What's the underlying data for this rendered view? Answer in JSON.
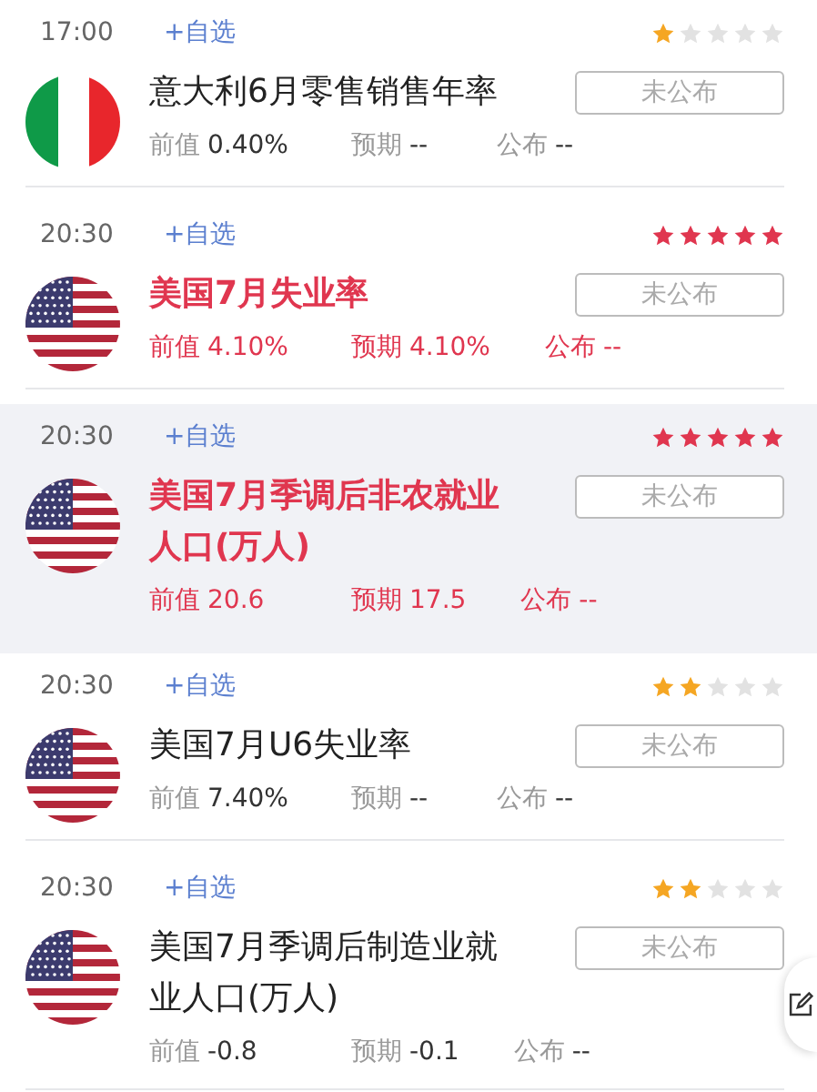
{
  "events": [
    {
      "time": "17:00",
      "watch": "+自选",
      "stars": 1,
      "kind": "italy",
      "title": "意大利6月零售销售年率",
      "important": false,
      "selected": false,
      "status": "未公布",
      "stats": [
        {
          "label": "前值",
          "value": "0.40%"
        },
        {
          "label": "预期",
          "value": "--"
        },
        {
          "label": "公布",
          "value": "--"
        }
      ]
    },
    {
      "time": "20:30",
      "watch": "+自选",
      "stars": 5,
      "kind": "usa",
      "title": "美国7月失业率",
      "important": true,
      "selected": false,
      "status": "未公布",
      "stats": [
        {
          "label": "前值",
          "value": "4.10%"
        },
        {
          "label": "预期",
          "value": "4.10%"
        },
        {
          "label": "公布",
          "value": "--"
        }
      ]
    },
    {
      "time": "20:30",
      "watch": "+自选",
      "stars": 5,
      "kind": "usa",
      "title": "美国7月季调后非农就业人口(万人)",
      "important": true,
      "selected": true,
      "status": "未公布",
      "stats": [
        {
          "label": "前值",
          "value": "20.6"
        },
        {
          "label": "预期",
          "value": "17.5"
        },
        {
          "label": "公布",
          "value": "--"
        }
      ]
    },
    {
      "time": "20:30",
      "watch": "+自选",
      "stars": 2,
      "kind": "usa",
      "title": "美国7月U6失业率",
      "important": false,
      "selected": false,
      "status": "未公布",
      "stats": [
        {
          "label": "前值",
          "value": "7.40%"
        },
        {
          "label": "预期",
          "value": "--"
        },
        {
          "label": "公布",
          "value": "--"
        }
      ]
    },
    {
      "time": "20:30",
      "watch": "+自选",
      "stars": 2,
      "kind": "usa",
      "title": "美国7月季调后制造业就业人口(万人)",
      "important": false,
      "selected": false,
      "status": "未公布",
      "stats": [
        {
          "label": "前值",
          "value": "-0.8"
        },
        {
          "label": "预期",
          "value": "-0.1"
        },
        {
          "label": "公布",
          "value": "--"
        }
      ]
    }
  ]
}
